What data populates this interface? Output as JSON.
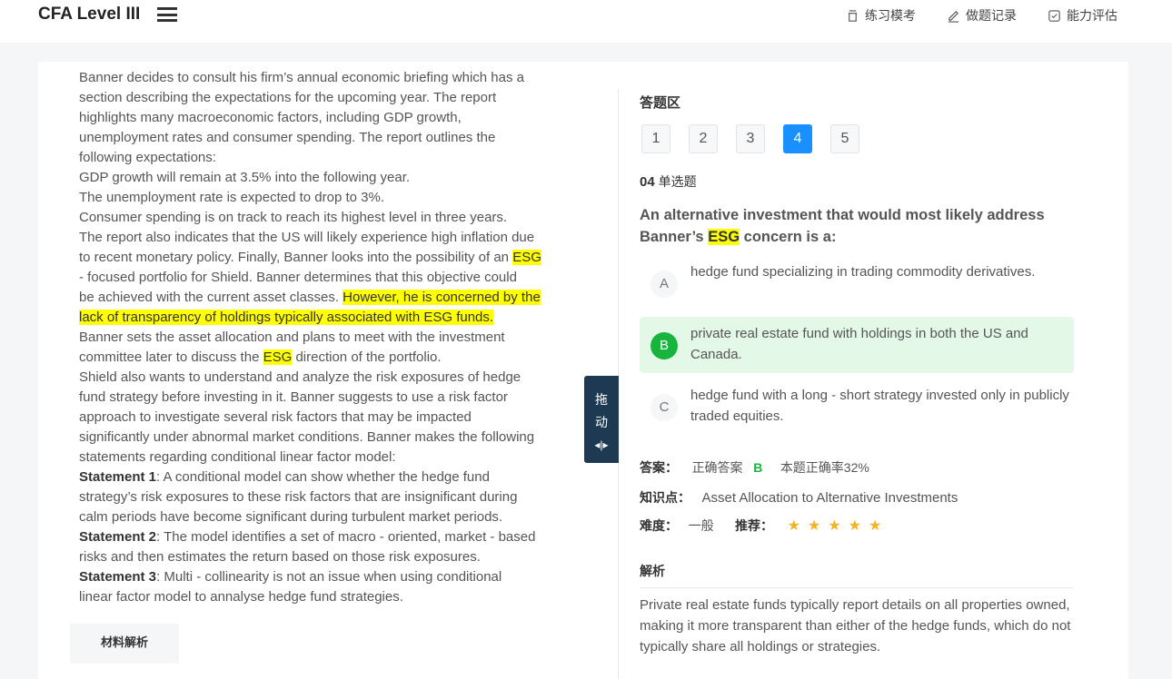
{
  "header": {
    "title": "CFA Level III",
    "nav": [
      {
        "label": "练习模考",
        "icon": "cup-icon"
      },
      {
        "label": "做题记录",
        "icon": "pencil-icon"
      },
      {
        "label": "能力评估",
        "icon": "checklist-icon"
      }
    ]
  },
  "passage": {
    "lines": [
      [
        {
          "t": "Banner decides to consult his firm’s annual economic briefing which has a"
        }
      ],
      [
        {
          "t": "section describing the expectations for the upcoming year. The report"
        }
      ],
      [
        {
          "t": "highlights many macroeconomic factors, including GDP growth,"
        }
      ],
      [
        {
          "t": "unemployment rates and consumer spending. The report outlines the"
        }
      ],
      [
        {
          "t": "following expectations:"
        }
      ],
      [
        {
          "t": "GDP growth will remain at 3.5% into the following year."
        }
      ],
      [
        {
          "t": "The unemployment rate is expected to drop to 3%."
        }
      ],
      [
        {
          "t": "Consumer spending is on track to reach its highest level in three years."
        }
      ],
      [
        {
          "t": "The report also indicates that the US will likely experience high inflation due"
        }
      ],
      [
        {
          "t": "to recent monetary policy. Finally, Banner looks into the possibility of an "
        },
        {
          "t": "ESG",
          "hl": true
        }
      ],
      [
        {
          "t": " - focused portfolio for Shield. Banner determines that this objective could"
        }
      ],
      [
        {
          "t": "be achieved with the current asset classes. "
        },
        {
          "t": "However, he is concerned by the",
          "hl": true
        }
      ],
      [
        {
          "t": "lack of transparency of holdings typically associated with ESG funds.",
          "hl": true
        }
      ],
      [
        {
          "t": "Banner sets the asset allocation and plans to meet with the investment"
        }
      ],
      [
        {
          "t": "committee later to discuss the "
        },
        {
          "t": "ESG",
          "hl": true
        },
        {
          "t": " direction of the portfolio."
        }
      ],
      [
        {
          "t": "Shield also wants to understand and analyze the risk exposures of hedge"
        }
      ],
      [
        {
          "t": "fund strategy before investing in it. Banner suggests to use a risk factor"
        }
      ],
      [
        {
          "t": "approach to investigate several risk factors that may be impacted"
        }
      ],
      [
        {
          "t": "significantly under abnormal market conditions. Banner makes the following"
        }
      ],
      [
        {
          "t": "statements regarding conditional linear factor model:"
        }
      ],
      [
        {
          "t": "Statement 1",
          "b": true
        },
        {
          "t": ": A conditional model can show whether the hedge fund"
        }
      ],
      [
        {
          "t": "strategy’s risk exposures to these risk factors that are insignificant during"
        }
      ],
      [
        {
          "t": "calm periods have become significant during turbulent market periods."
        }
      ],
      [
        {
          "t": "Statement 2",
          "b": true
        },
        {
          "t": ": The model identifies a set of macro - oriented, market - based"
        }
      ],
      [
        {
          "t": "risks and then estimates the return based on those risk exposures."
        }
      ],
      [
        {
          "t": "Statement 3",
          "b": true
        },
        {
          "t": ": Multi - collinearity is not an issue when using conditional"
        }
      ],
      [
        {
          "t": "linear factor model to annalyse hedge fund strategies."
        }
      ]
    ],
    "drag_handle": [
      "拖",
      "动"
    ],
    "material_button": "材料解析"
  },
  "answer": {
    "section_title": "答题区",
    "numbers": [
      "1",
      "2",
      "3",
      "4",
      "5"
    ],
    "active_number": "4",
    "qnum": "04",
    "qtype": "单选题",
    "question_pre": "An alternative investment that would most likely address Banner’s ",
    "question_hl": "ESG",
    "question_post": " concern is a:",
    "options": [
      {
        "letter": "A",
        "text": "hedge fund specializing in trading commodity derivatives."
      },
      {
        "letter": "B",
        "text": "private real estate fund with holdings in both the US and Canada."
      },
      {
        "letter": "C",
        "text": "hedge fund with a long - short strategy invested only in publicly traded equities."
      }
    ],
    "selected": "B",
    "answer_label": "答案：",
    "correct_label": "正确答案",
    "correct": "B",
    "rate": "本题正确率32%",
    "knowledge_label": "知识点：",
    "knowledge": "Asset Allocation to Alternative Investments",
    "difficulty_label": "难度：",
    "difficulty": "一般",
    "recommend_label": "推荐：",
    "stars": 5,
    "analysis_title": "解析",
    "analysis": "Private real estate funds typically report details on all properties owned, making it more transparent than either of the hedge funds, which do not typically share all holdings or strategies."
  },
  "colors": {
    "accent": "#1890ff",
    "correct": "#17b53e",
    "highlight": "#ffff00",
    "handle": "#1d3a52"
  }
}
